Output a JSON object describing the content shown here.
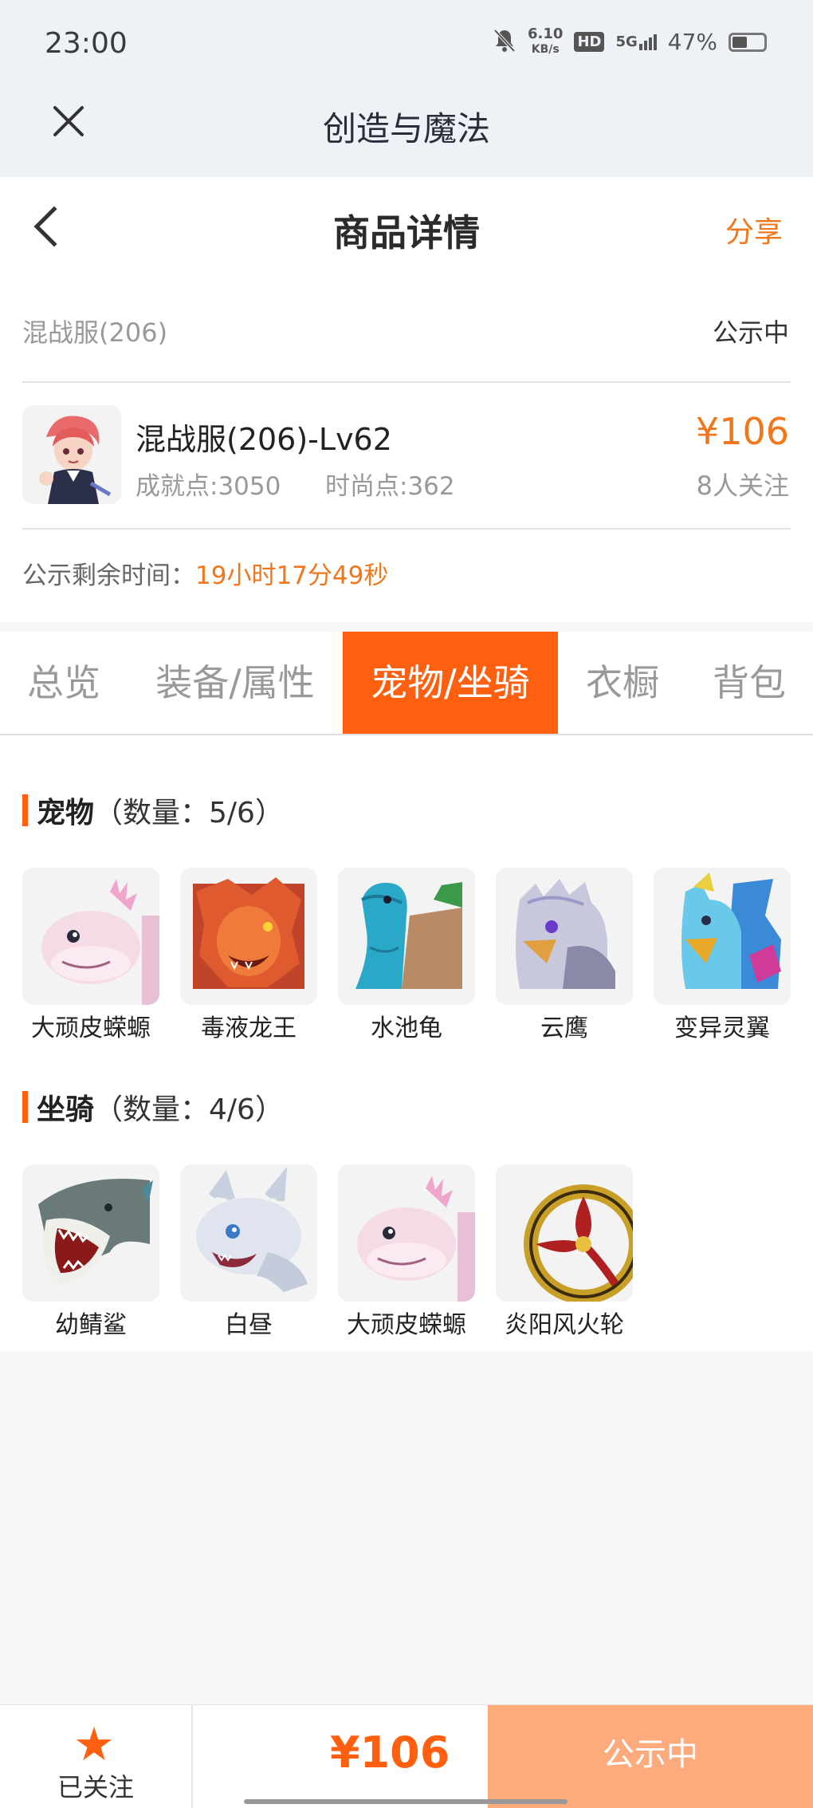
{
  "status": {
    "time": "23:00",
    "speed_value": "6.10",
    "speed_unit": "KB/s",
    "hd": "HD",
    "network": "5G",
    "battery": "47%",
    "battery_level": 0.47
  },
  "app": {
    "title": "创造与魔法"
  },
  "nav": {
    "title": "商品详情",
    "share": "分享"
  },
  "listing": {
    "server": "混战服(206)",
    "state": "公示中",
    "name": "混战服(206)-Lv62",
    "achievement": "成就点:3050",
    "fashion": "时尚点:362",
    "price": "¥106",
    "followers": "8人关注",
    "remain_label": "公示剩余时间：",
    "remain_value": "19小时17分49秒"
  },
  "tabs": [
    {
      "label": "总览",
      "active": false
    },
    {
      "label": "装备/属性",
      "active": false
    },
    {
      "label": "宠物/坐骑",
      "active": true
    },
    {
      "label": "衣橱",
      "active": false
    },
    {
      "label": "背包",
      "active": false
    }
  ],
  "pets": {
    "title": "宠物",
    "count": "（数量：5/6）",
    "items": [
      {
        "name": "大顽皮蝾螈",
        "icon": "axolotl-icon"
      },
      {
        "name": "毒液龙王",
        "icon": "dragon-king-icon"
      },
      {
        "name": "水池龟",
        "icon": "pond-turtle-icon"
      },
      {
        "name": "云鹰",
        "icon": "cloud-eagle-icon"
      },
      {
        "name": "变异灵翼",
        "icon": "mutant-wing-icon"
      }
    ]
  },
  "mounts": {
    "title": "坐骑",
    "count": "（数量：4/6）",
    "items": [
      {
        "name": "幼鲭鲨",
        "icon": "shark-icon"
      },
      {
        "name": "白昼",
        "icon": "white-dragon-icon"
      },
      {
        "name": "大顽皮蝾螈",
        "icon": "axolotl-icon"
      },
      {
        "name": "炎阳风火轮",
        "icon": "fire-wheel-icon"
      }
    ]
  },
  "bottom": {
    "fav_label": "已关注",
    "price": "¥106",
    "action": "公示中"
  },
  "colors": {
    "accent": "#ff6010",
    "price": "#f0771c",
    "action_bg": "#fdaa7c"
  }
}
